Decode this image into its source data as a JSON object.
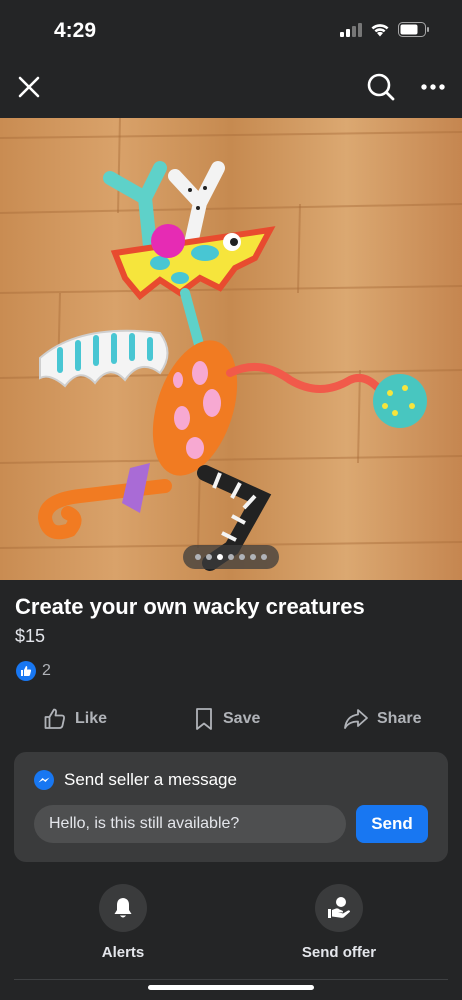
{
  "status": {
    "time": "4:29"
  },
  "nav": {
    "close_icon": "close-icon",
    "search_icon": "search-icon",
    "more_icon": "more-icon"
  },
  "photo": {
    "description_icon": "product-photo",
    "page_count": 7,
    "active_page": 2
  },
  "listing": {
    "title": "Create your own wacky creatures",
    "price": "$15",
    "likes_count": "2"
  },
  "actions": {
    "like_label": "Like",
    "save_label": "Save",
    "share_label": "Share"
  },
  "message": {
    "title": "Send seller a message",
    "input_value": "Hello, is this still available?",
    "send_label": "Send"
  },
  "bottom": {
    "alerts_label": "Alerts",
    "offer_label": "Send offer"
  },
  "colors": {
    "accent": "#1877f2",
    "background": "#242526",
    "card": "#3a3b3c"
  }
}
